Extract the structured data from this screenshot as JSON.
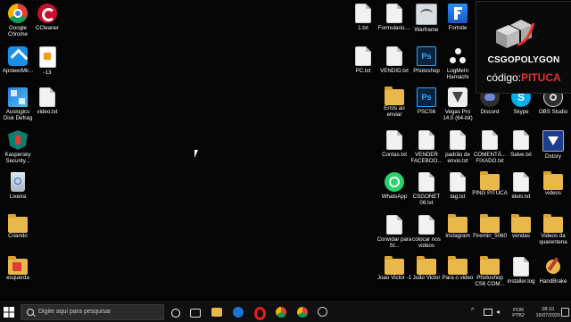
{
  "desktop": {
    "left_icons": [
      {
        "label": "Google Chrome",
        "icon": "chrome-icon"
      },
      {
        "label": "CCleaner",
        "icon": "ccleaner-icon"
      },
      {
        "label": "ApowerMir...",
        "icon": "apowermirror-icon"
      },
      {
        "label": "-13",
        "icon": "image-file-icon"
      },
      {
        "label": "Auslogics Disk Defrag",
        "icon": "auslogics-icon"
      },
      {
        "label": "video.txt",
        "icon": "text-file-icon"
      },
      {
        "label": "Kaspersky Security...",
        "icon": "kaspersky-icon"
      },
      {
        "label": "Lixeira",
        "icon": "recycle-bin-icon"
      },
      {
        "label": "Criando",
        "icon": "folder-icon"
      },
      {
        "label": "esquerda",
        "icon": "folder-icon"
      }
    ],
    "right_icons": [
      {
        "label": "1.txt",
        "icon": "text-file-icon"
      },
      {
        "label": "Formulario....",
        "icon": "text-file-icon"
      },
      {
        "label": "Warframe",
        "icon": "warframe-icon"
      },
      {
        "label": "Fortnite",
        "icon": "fortnite-icon"
      },
      {
        "label": "PC.txt",
        "icon": "text-file-icon"
      },
      {
        "label": "VENDID.txt",
        "icon": "text-file-icon"
      },
      {
        "label": "Photoshop",
        "icon": "photoshop-icon"
      },
      {
        "label": "LogMeIn Hamachi",
        "icon": "hamachi-icon"
      },
      {
        "label": "Erros ao enviar",
        "icon": "folder-icon"
      },
      {
        "label": "PSCS6",
        "icon": "photoshop-icon"
      },
      {
        "label": "Vegas Pro 14.0 (64-bit)",
        "icon": "vegas-icon"
      },
      {
        "label": "Discord",
        "icon": "discord-icon"
      },
      {
        "label": "Skype",
        "icon": "skype-icon"
      },
      {
        "label": "OBS Studio",
        "icon": "obs-icon"
      },
      {
        "label": "Contas.txt",
        "icon": "text-file-icon"
      },
      {
        "label": "VENDER FACEBOO...",
        "icon": "text-file-icon"
      },
      {
        "label": "padrão de envio.txt",
        "icon": "text-file-icon"
      },
      {
        "label": "COMENTÁ... FIXADO.txt",
        "icon": "text-file-icon"
      },
      {
        "label": "Salve.txt",
        "icon": "text-file-icon"
      },
      {
        "label": "Dxtory",
        "icon": "dxtory-icon"
      },
      {
        "label": "WhatsApp",
        "icon": "whatsapp-icon"
      },
      {
        "label": "CSGONET 06.txt",
        "icon": "text-file-icon"
      },
      {
        "label": "tag.txt",
        "icon": "text-file-icon"
      },
      {
        "label": "PING PITUCA",
        "icon": "folder-icon"
      },
      {
        "label": "ideis.txt",
        "icon": "text-file-icon"
      },
      {
        "label": "videos",
        "icon": "folder-icon"
      },
      {
        "label": "Convidar para St...",
        "icon": "text-file-icon"
      },
      {
        "label": "colocar nos videos",
        "icon": "text-file-icon"
      },
      {
        "label": "Instagram",
        "icon": "folder-icon"
      },
      {
        "label": "Firemin_5060",
        "icon": "folder-icon"
      },
      {
        "label": "vendas",
        "icon": "folder-icon"
      },
      {
        "label": "Videos da quarentena",
        "icon": "folder-icon"
      },
      {
        "label": "Joao Victor -1",
        "icon": "folder-icon"
      },
      {
        "label": "João Victor",
        "icon": "folder-icon"
      },
      {
        "label": "Para o video",
        "icon": "folder-icon"
      },
      {
        "label": "Photoshop CS6 COM...",
        "icon": "folder-icon"
      },
      {
        "label": "installer.log",
        "icon": "text-file-icon"
      },
      {
        "label": "HandBrake",
        "icon": "handbrake-icon"
      }
    ]
  },
  "promo": {
    "brand": "CSGOPOLYGON",
    "code_prefix": "código:",
    "code_value": "PITUCA"
  },
  "taskbar": {
    "search_placeholder": "Digite aqui para pesquisar",
    "apps": [
      "task-view-icon",
      "file-explorer-icon",
      "edge-icon",
      "opera-icon",
      "chrome-icon",
      "chrome-icon",
      "steam-icon"
    ],
    "lang_line1": "POR",
    "lang_line2": "PTB2",
    "time": "08:10",
    "date": "16/07/2020"
  },
  "colors": {
    "folder": "#e8b94a",
    "accent_red": "#e8312e",
    "taskbar": "#101010"
  }
}
